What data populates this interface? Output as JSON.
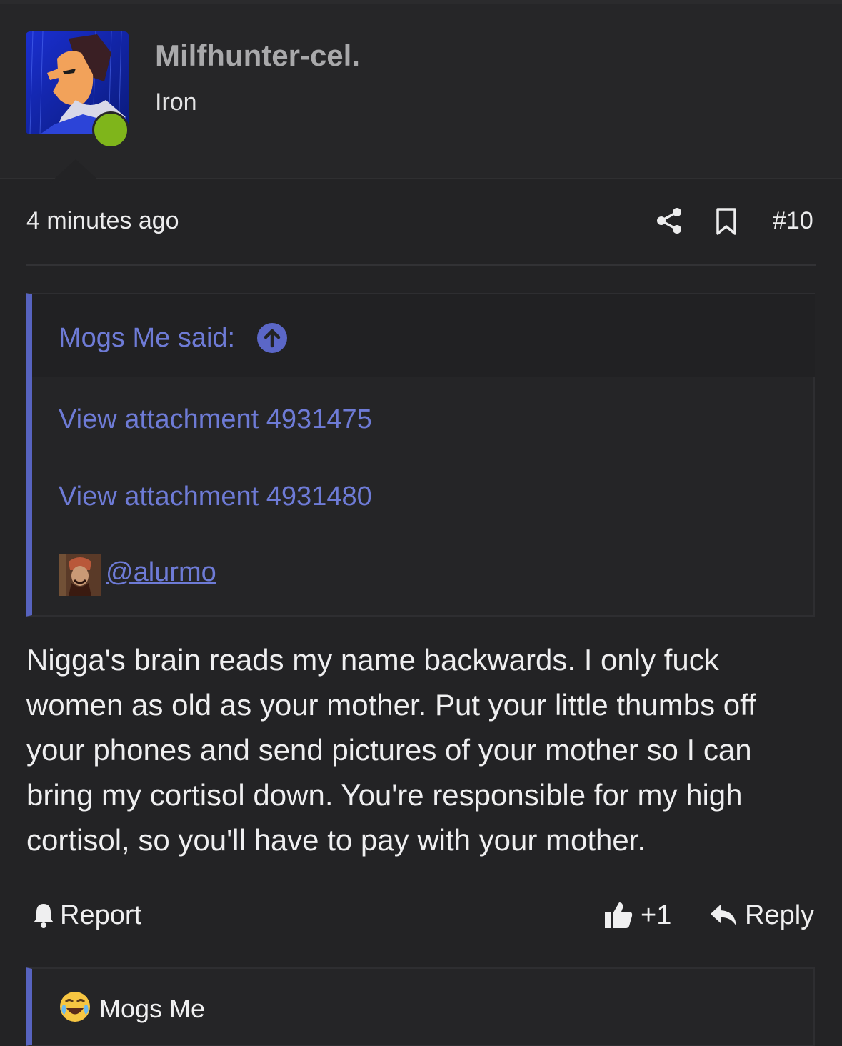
{
  "user": {
    "name": "Milfhunter-cel.",
    "title": "Iron",
    "online": true
  },
  "post": {
    "time": "4 minutes ago",
    "number": "#10",
    "body": "Nigga's brain reads my name backwards. I only fuck women as old as your mother. Put your little thumbs off your phones and send pictures of your mother so I can bring my cortisol down. You're responsible for my high cortisol, so you'll have to pay with your mother."
  },
  "quote": {
    "author_said": "Mogs Me said:",
    "attachments": [
      "View attachment 4931475",
      "View attachment 4931480"
    ],
    "mention": "@alurmo"
  },
  "actions": {
    "report": "Report",
    "like_count": "+1",
    "reply": "Reply"
  },
  "reactions": {
    "user": "Mogs Me",
    "emoji": "crying-laughing"
  },
  "colors": {
    "background": "#232325",
    "accent": "#6e7bd6",
    "online": "#7fb51b"
  }
}
